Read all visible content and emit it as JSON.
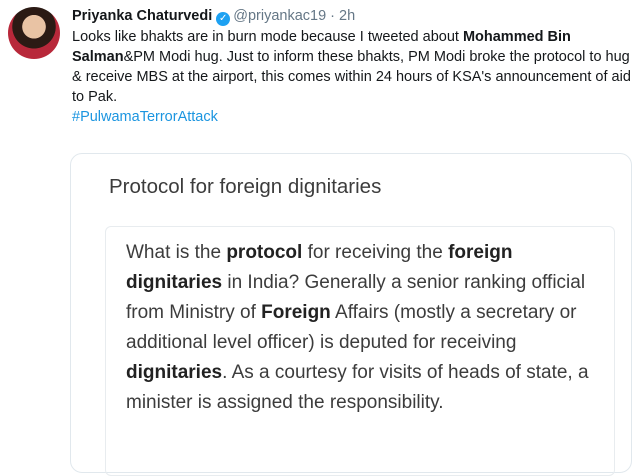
{
  "tweet": {
    "author_name": "Priyanka Chaturvedi",
    "verified_mark": "✓",
    "handle": "@priyankac19",
    "separator": "·",
    "time": "2h",
    "text_1": "Looks like bhakts are in burn mode because I tweeted about ",
    "bold_1": "Mohammed Bin Salman",
    "text_2": "&PM Modi hug. Just to inform these bhakts, PM Modi broke the protocol to hug & receive MBS at the airport, this comes within 24 hours of KSA's announcement of aid to Pak.",
    "hashtag": "#PulwamaTerrorAttack"
  },
  "card": {
    "title": "Protocol for foreign dignitaries",
    "answer": [
      {
        "t": "What is the ",
        "b": false
      },
      {
        "t": "protocol",
        "b": true
      },
      {
        "t": " for receiving the ",
        "b": false
      },
      {
        "t": "foreign dignitaries",
        "b": true
      },
      {
        "t": " in India? Generally a senior ranking official from Ministry of ",
        "b": false
      },
      {
        "t": "Foreign",
        "b": true
      },
      {
        "t": " Affairs (mostly a secretary or additional level officer) is deputed for receiving ",
        "b": false
      },
      {
        "t": "dignitaries",
        "b": true
      },
      {
        "t": ". As a courtesy for visits of heads of state, a minister is assigned the responsibility.",
        "b": false
      }
    ]
  },
  "colors": {
    "link": "#1b95e0",
    "verified": "#1da1f2",
    "muted": "#657786"
  },
  "icons": {
    "verified": "verified-badge-icon",
    "avatar": "profile-avatar"
  }
}
